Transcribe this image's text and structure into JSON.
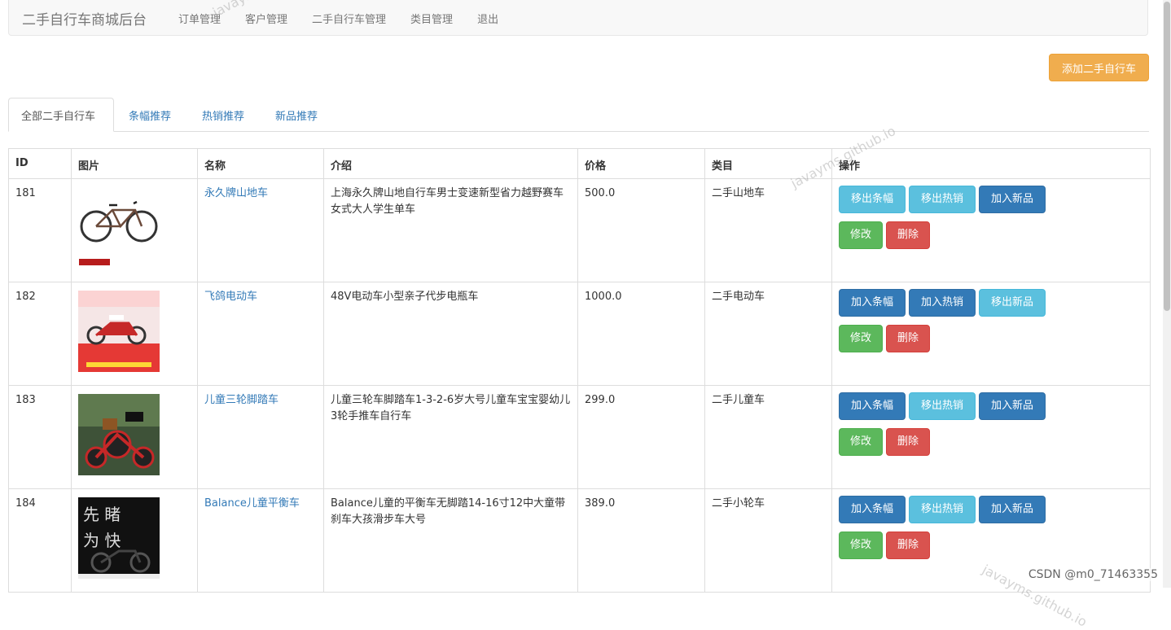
{
  "navbar": {
    "brand": "二手自行车商城后台",
    "links": [
      "订单管理",
      "客户管理",
      "二手自行车管理",
      "类目管理",
      "退出"
    ]
  },
  "add_button": "添加二手自行车",
  "tabs": [
    "全部二手自行车",
    "条幅推荐",
    "热销推荐",
    "新品推荐"
  ],
  "table": {
    "headers": [
      "ID",
      "图片",
      "名称",
      "介绍",
      "价格",
      "类目",
      "操作"
    ],
    "rows": [
      {
        "id": "181",
        "name": "永久牌山地车",
        "desc": "上海永久牌山地自行车男士变速新型省力越野赛车女式大人学生单车",
        "price": "500.0",
        "category": "二手山地车",
        "image": "mountain-bike-photo",
        "buttons": [
          {
            "label": "移出条幅",
            "style": "info"
          },
          {
            "label": "移出热销",
            "style": "info"
          },
          {
            "label": "加入新品",
            "style": "primary"
          },
          {
            "label": "修改",
            "style": "success"
          },
          {
            "label": "删除",
            "style": "danger"
          }
        ]
      },
      {
        "id": "182",
        "name": "飞鸽电动车",
        "desc": "48V电动车小型亲子代步电瓶车",
        "price": "1000.0",
        "category": "二手电动车",
        "image": "electric-scooter-photo",
        "buttons": [
          {
            "label": "加入条幅",
            "style": "primary"
          },
          {
            "label": "加入热销",
            "style": "primary"
          },
          {
            "label": "移出新品",
            "style": "info"
          },
          {
            "label": "修改",
            "style": "success"
          },
          {
            "label": "删除",
            "style": "danger"
          }
        ]
      },
      {
        "id": "183",
        "name": "儿童三轮脚踏车",
        "desc": "儿童三轮车脚踏车1-3-2-6岁大号儿童车宝宝婴幼儿3轮手推车自行车",
        "price": "299.0",
        "category": "二手儿童车",
        "image": "kids-tricycle-photo",
        "buttons": [
          {
            "label": "加入条幅",
            "style": "primary"
          },
          {
            "label": "移出热销",
            "style": "info"
          },
          {
            "label": "加入新品",
            "style": "primary"
          },
          {
            "label": "修改",
            "style": "success"
          },
          {
            "label": "删除",
            "style": "danger"
          }
        ]
      },
      {
        "id": "184",
        "name": "Balance儿童平衡车",
        "desc": "Balance儿童的平衡车无脚踏14-16寸12中大童带刹车大孩滑步车大号",
        "price": "389.0",
        "category": "二手小轮车",
        "image": "balance-bike-photo",
        "buttons": [
          {
            "label": "加入条幅",
            "style": "primary"
          },
          {
            "label": "移出热销",
            "style": "info"
          },
          {
            "label": "加入新品",
            "style": "primary"
          },
          {
            "label": "修改",
            "style": "success"
          },
          {
            "label": "删除",
            "style": "danger"
          }
        ]
      }
    ]
  },
  "watermarks": [
    "javayms.github.io",
    "javayms.github.io",
    "javayms.github.io"
  ],
  "csdn_credit": "CSDN @m0_71463355"
}
